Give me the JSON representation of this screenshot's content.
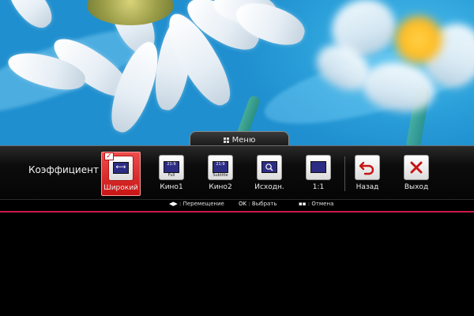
{
  "menu_tab": {
    "label": "Меню",
    "icon": "menu-grid-icon"
  },
  "panel": {
    "title": "Коэффициент"
  },
  "buttons": [
    {
      "label": "Широкий",
      "icon": "wide-aspect-icon",
      "selected": true
    },
    {
      "label": "Кино1",
      "icon": "cinema1-aspect-icon",
      "screen_text": "21:9",
      "sub_text": "Full"
    },
    {
      "label": "Кино2",
      "icon": "cinema2-aspect-icon",
      "screen_text": "21:9",
      "sub_text": "Subtitle"
    },
    {
      "label": "Исходн.",
      "icon": "original-zoom-icon"
    },
    {
      "label": "1:1",
      "icon": "one-to-one-icon"
    },
    {
      "label": "Назад",
      "icon": "back-arrow-icon"
    },
    {
      "label": "Выход",
      "icon": "close-x-icon"
    }
  ],
  "hints": [
    {
      "key": "◀▶",
      "text": ": Перемещение"
    },
    {
      "key": "OK",
      "text": ": Выбрать"
    },
    {
      "key": "▪▪",
      "text": ": Отмена"
    }
  ],
  "colors": {
    "accent": "#c81414",
    "panel": "#0c0c0c",
    "hint_line": "#c81a4a",
    "screen": "#2c2c84"
  }
}
